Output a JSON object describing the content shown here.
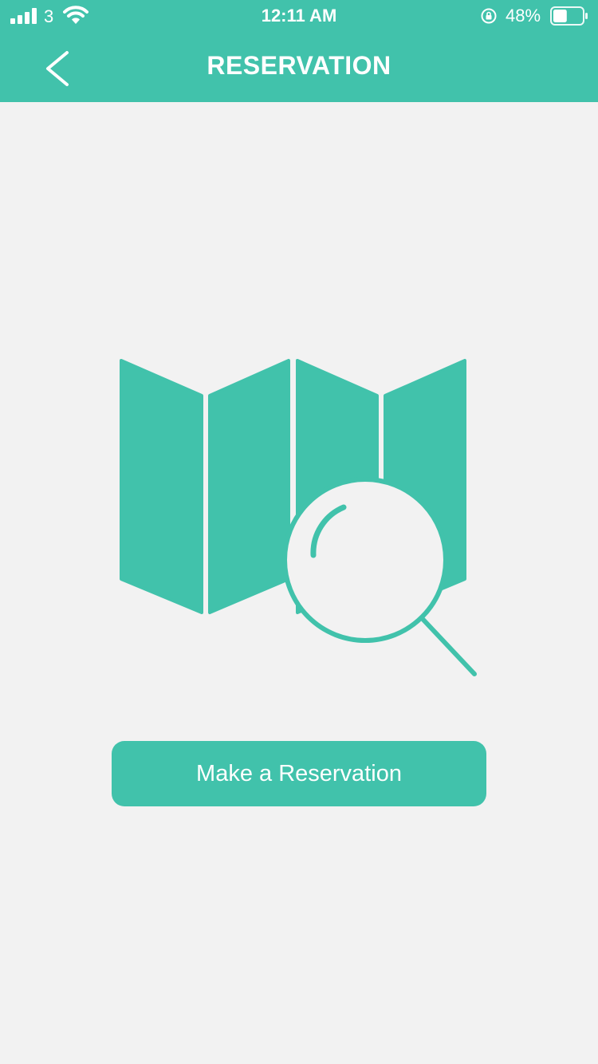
{
  "status_bar": {
    "carrier": "3",
    "time": "12:11 AM",
    "battery_percent": "48%",
    "battery_level": 0.48,
    "icons": [
      "signal-bars-icon",
      "wifi-icon",
      "orientation-lock-icon",
      "battery-icon"
    ]
  },
  "navbar": {
    "title": "RESERVATION",
    "back_icon": "chevron-left-icon"
  },
  "illustration": {
    "icon": "map-search-icon"
  },
  "actions": {
    "make_reservation_label": "Make a Reservation"
  },
  "colors": {
    "accent": "#41c2ab",
    "background": "#f2f2f2",
    "text_on_accent": "#ffffff"
  }
}
